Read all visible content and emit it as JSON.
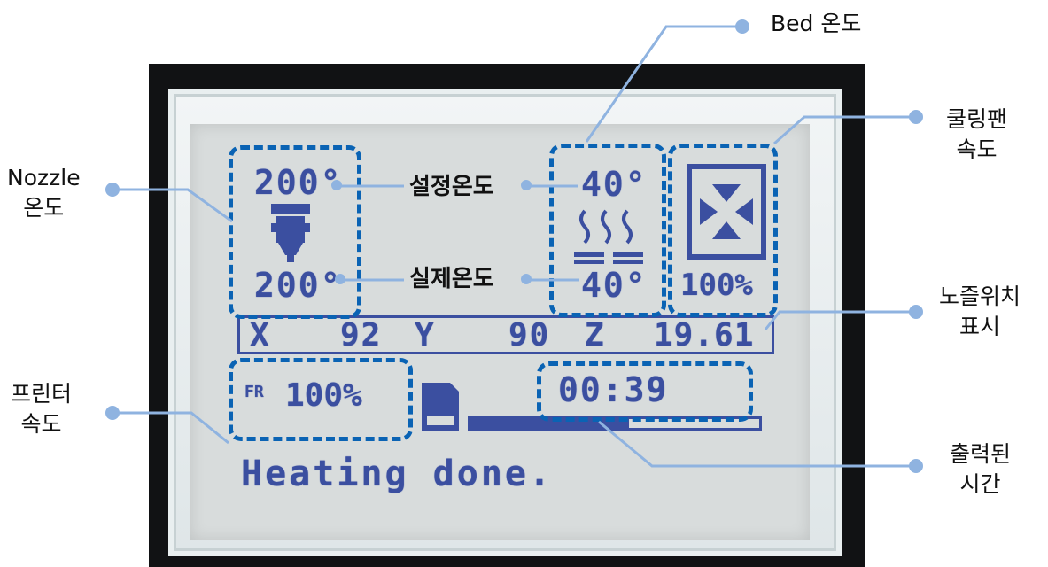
{
  "annotations": {
    "bed_temp": "Bed 온도",
    "fan_speed_line1": "쿨링팬",
    "fan_speed_line2": "속도",
    "nozzle_temp_line1": "Nozzle",
    "nozzle_temp_line2": "온도",
    "set_temp": "설정온도",
    "actual_temp": "실제온도",
    "nozzle_pos_line1": "노즐위치",
    "nozzle_pos_line2": "표시",
    "print_speed_line1": "프린터",
    "print_speed_line2": "속도",
    "elapsed_line1": "출력된",
    "elapsed_line2": "시간"
  },
  "lcd": {
    "nozzle_set": "200°",
    "nozzle_actual": "200°",
    "bed_set": "40°",
    "bed_actual": "40°",
    "fan_percent": "100%",
    "x_label": "X",
    "x_value": "92",
    "y_label": "Y",
    "y_value": "90",
    "z_label": "Z",
    "z_value": "19.61",
    "feedrate_symbol": "FR",
    "feedrate_percent": "100%",
    "elapsed_time": "00:39",
    "status_message": "Heating done.",
    "progress_fraction": 0.55
  },
  "colors": {
    "lcd_pixel": "#3b4fa0",
    "lcd_bg": "#d8dcdc",
    "callout_dash": "#0a63b4",
    "leader_line": "#8fb3e0"
  }
}
